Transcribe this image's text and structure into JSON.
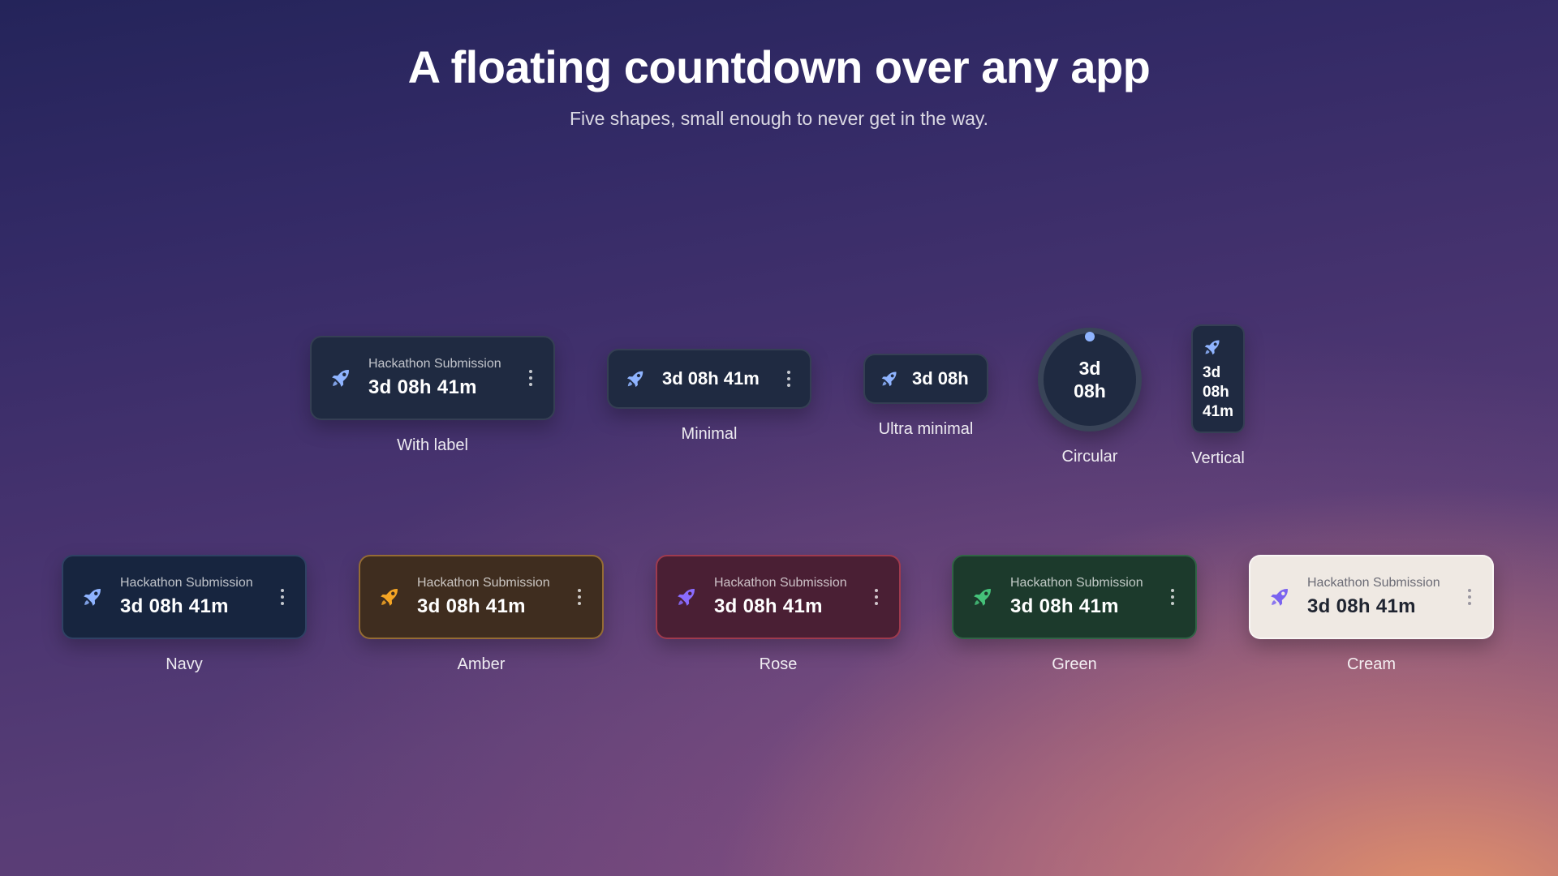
{
  "header": {
    "title": "A floating countdown over any app",
    "subtitle": "Five shapes, small enough to never get in the way."
  },
  "shapes": {
    "with_label": {
      "label": "Hackathon Submission",
      "time": "3d 08h 41m",
      "caption": "With label"
    },
    "minimal": {
      "time": "3d 08h 41m",
      "caption": "Minimal"
    },
    "ultra_minimal": {
      "time": "3d 08h",
      "caption": "Ultra minimal"
    },
    "circular": {
      "line1": "3d",
      "line2": "08h",
      "caption": "Circular"
    },
    "vertical": {
      "line1": "3d",
      "line2": "08h",
      "line3": "41m",
      "caption": "Vertical"
    }
  },
  "themes": [
    {
      "label": "Hackathon Submission",
      "time": "3d 08h 41m",
      "caption": "Navy",
      "icon_color": "#8fb4ff"
    },
    {
      "label": "Hackathon Submission",
      "time": "3d 08h 41m",
      "caption": "Amber",
      "icon_color": "#f5a524"
    },
    {
      "label": "Hackathon Submission",
      "time": "3d 08h 41m",
      "caption": "Rose",
      "icon_color": "#8a6cff"
    },
    {
      "label": "Hackathon Submission",
      "time": "3d 08h 41m",
      "caption": "Green",
      "icon_color": "#45c27a"
    },
    {
      "label": "Hackathon Submission",
      "time": "3d 08h 41m",
      "caption": "Cream",
      "icon_color": "#7a63f0"
    }
  ],
  "icons": {
    "rocket": "rocket-icon",
    "menu": "more-vertical-icon"
  },
  "colors": {
    "widget_bg": "#1f2a41",
    "navy": "#17253f",
    "amber": "#3f2d1f",
    "rose": "#4a1f34",
    "green": "#1c3a2c",
    "cream": "#efe9e3",
    "progress_dot": "#8fb4ff"
  }
}
